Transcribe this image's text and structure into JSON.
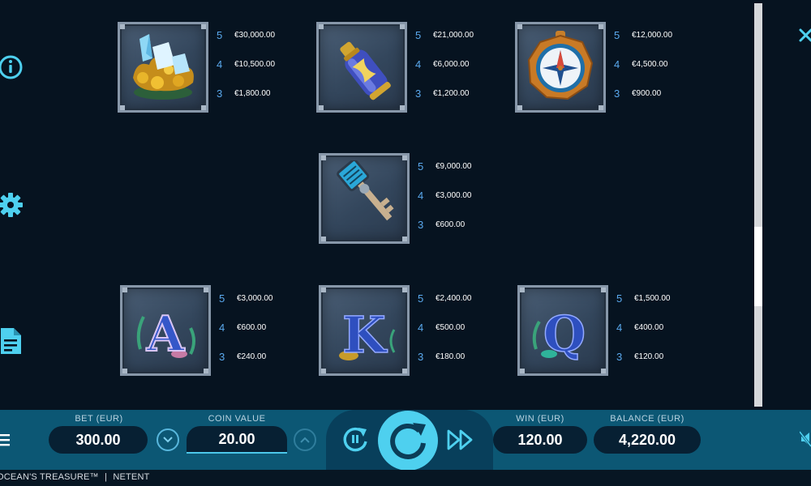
{
  "game": {
    "footer_title": "OCEAN'S TREASURE™",
    "separator": "|",
    "provider": "NETENT"
  },
  "sidebar": {
    "icons": [
      "info-icon",
      "gear-icon",
      "document-icon"
    ]
  },
  "close_icon": "close-icon",
  "paytable": {
    "symbols": [
      {
        "name": "gold-gems",
        "pays": [
          {
            "count": "5",
            "amount": "€30,000.00"
          },
          {
            "count": "4",
            "amount": "€10,500.00"
          },
          {
            "count": "3",
            "amount": "€1,800.00"
          }
        ]
      },
      {
        "name": "bottle",
        "pays": [
          {
            "count": "5",
            "amount": "€21,000.00"
          },
          {
            "count": "4",
            "amount": "€6,000.00"
          },
          {
            "count": "3",
            "amount": "€1,200.00"
          }
        ]
      },
      {
        "name": "compass",
        "pays": [
          {
            "count": "5",
            "amount": "€12,000.00"
          },
          {
            "count": "4",
            "amount": "€4,500.00"
          },
          {
            "count": "3",
            "amount": "€900.00"
          }
        ]
      },
      {
        "name": "key",
        "pays": [
          {
            "count": "5",
            "amount": "€9,000.00"
          },
          {
            "count": "4",
            "amount": "€3,000.00"
          },
          {
            "count": "3",
            "amount": "€600.00"
          }
        ]
      },
      {
        "name": "letter-a",
        "letter": "A",
        "pays": [
          {
            "count": "5",
            "amount": "€3,000.00"
          },
          {
            "count": "4",
            "amount": "€600.00"
          },
          {
            "count": "3",
            "amount": "€240.00"
          }
        ]
      },
      {
        "name": "letter-k",
        "letter": "K",
        "pays": [
          {
            "count": "5",
            "amount": "€2,400.00"
          },
          {
            "count": "4",
            "amount": "€500.00"
          },
          {
            "count": "3",
            "amount": "€180.00"
          }
        ]
      },
      {
        "name": "letter-q",
        "letter": "Q",
        "pays": [
          {
            "count": "5",
            "amount": "€1,500.00"
          },
          {
            "count": "4",
            "amount": "€400.00"
          },
          {
            "count": "3",
            "amount": "€120.00"
          }
        ]
      }
    ]
  },
  "controls": {
    "bet_label": "BET (EUR)",
    "bet_value": "300.00",
    "coin_label": "COIN VALUE",
    "coin_value": "20.00",
    "win_label": "WIN (EUR)",
    "win_value": "120.00",
    "balance_label": "BALANCE (EUR)",
    "balance_value": "4,220.00"
  },
  "colors": {
    "accent": "#4ed0ef",
    "bar": "#0c5774",
    "background": "#061320",
    "multiplier": "#5aa9ee"
  }
}
